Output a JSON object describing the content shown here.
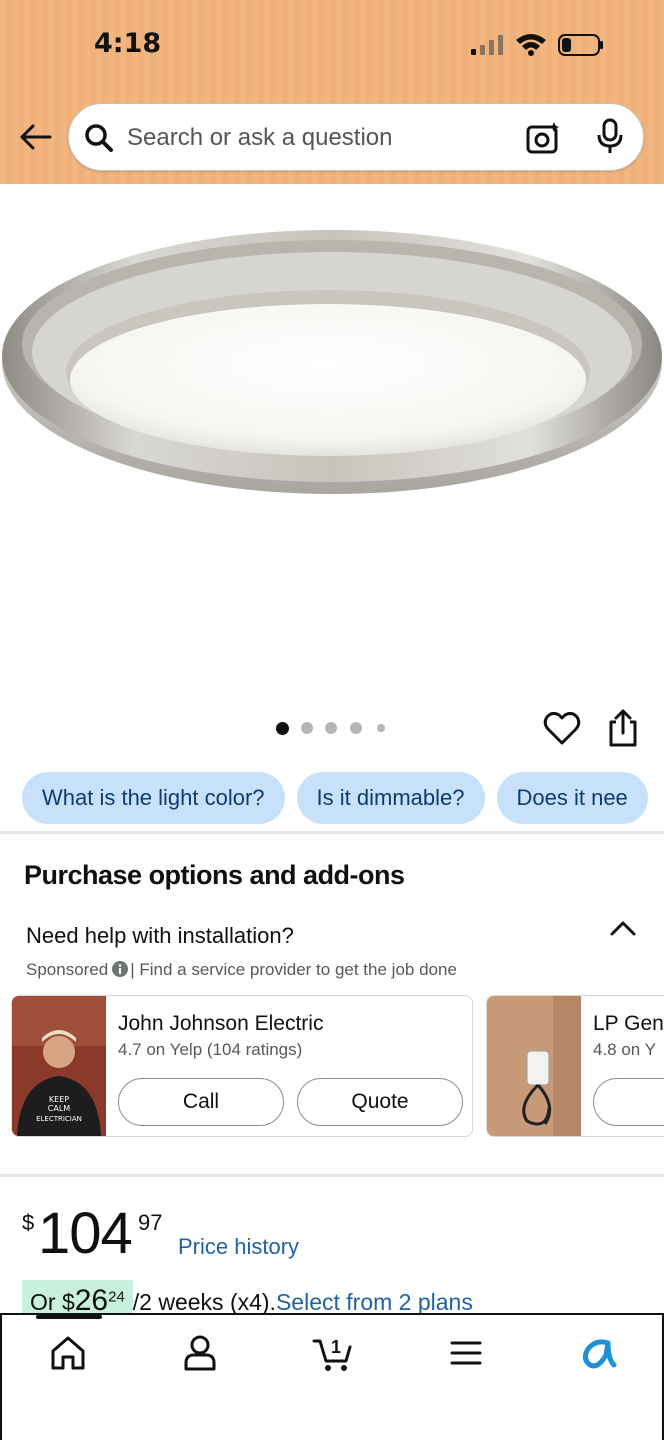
{
  "status_bar": {
    "time": "4:18"
  },
  "search": {
    "placeholder": "Search or ask a question"
  },
  "carousel": {
    "total_dots": 5,
    "active_index": 0
  },
  "question_chips": [
    "What is the light color?",
    "Is it dimmable?",
    "Does it nee"
  ],
  "purchase_options": {
    "title": "Purchase options and add-ons",
    "help_title": "Need help with installation?",
    "sponsored_label": "Sponsored",
    "sponsored_text": "| Find a service provider to get the job done"
  },
  "providers": [
    {
      "name": "John Johnson Electric",
      "rating": "4.7 on Yelp (104 ratings)",
      "call_label": "Call",
      "quote_label": "Quote"
    },
    {
      "name": "LP Gen",
      "rating": "4.8 on Y"
    }
  ],
  "price": {
    "symbol": "$",
    "whole": "104",
    "cents": "97",
    "history_label": "Price history",
    "installment_prefix": "Or $",
    "installment_whole": "26",
    "installment_cents": "24",
    "installment_suffix": "/2 weeks (x4).",
    "plans_link": "Select from 2 plans"
  },
  "bottom_nav": {
    "cart_count": "1"
  },
  "colors": {
    "header_bg": "#f2b67e",
    "chip_bg": "#c7e1fb",
    "link": "#2162a1",
    "installment_bg": "#c9f0dd",
    "rufus": "#1f8fd6"
  },
  "icons": [
    "back-arrow-icon",
    "search-icon",
    "camera-icon",
    "mic-icon",
    "heart-icon",
    "share-icon",
    "chevron-up-icon",
    "info-icon",
    "home-icon",
    "account-icon",
    "cart-icon",
    "menu-icon",
    "rufus-icon"
  ]
}
